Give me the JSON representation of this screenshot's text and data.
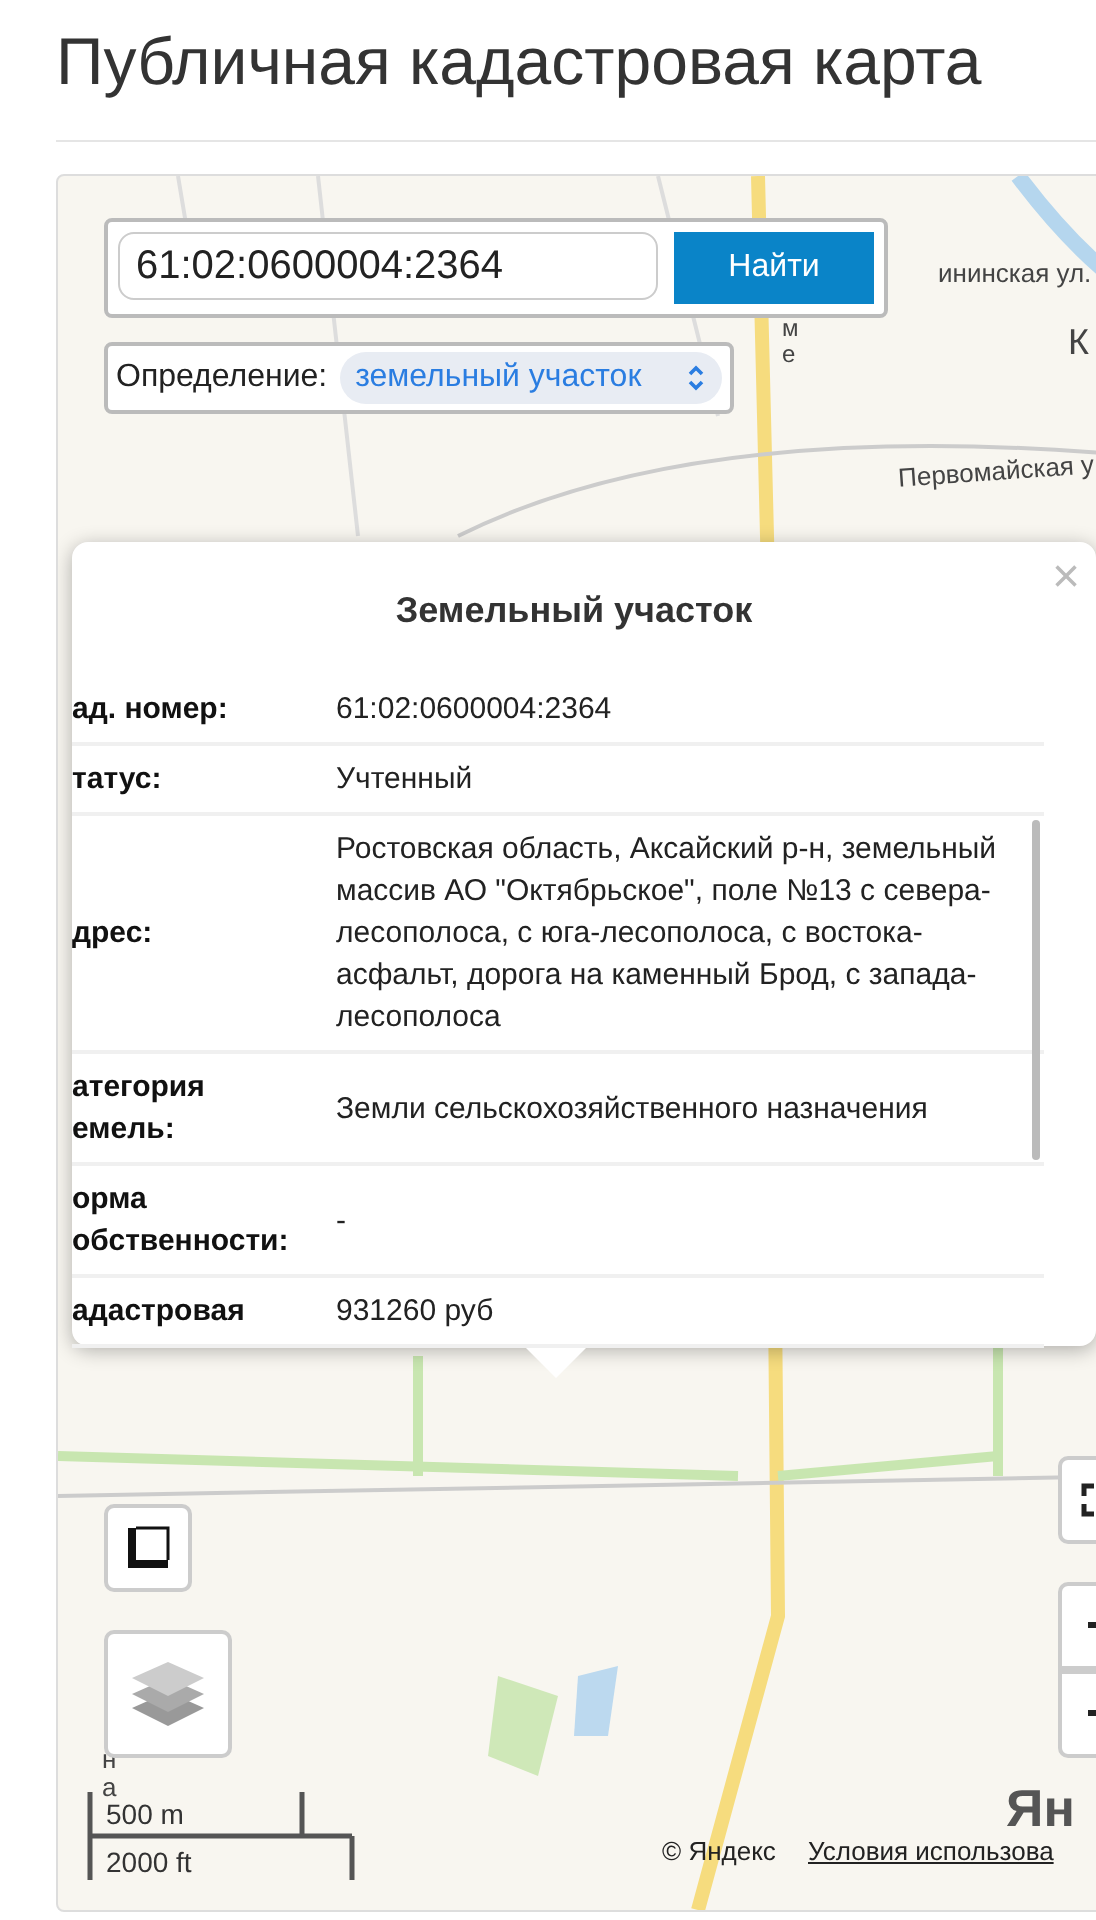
{
  "page_title": "Публичная кадастровая карта",
  "search": {
    "value": "61:02:0600004:2364",
    "button": "Найти"
  },
  "definition": {
    "label": "Определение:",
    "value": "земельный участок"
  },
  "map_labels": [
    {
      "text": "ининская ул."
    },
    {
      "text": "ме"
    },
    {
      "text": "К"
    },
    {
      "text": "Первомайская у"
    },
    {
      "text": "на"
    }
  ],
  "popup": {
    "title": "Земельный участок",
    "close": "×",
    "rows": [
      {
        "label": "ад. номер:",
        "value": "61:02:0600004:2364"
      },
      {
        "label": "татус:",
        "value": "Учтенный"
      },
      {
        "label": "дрес:",
        "value": "Ростовская область, Аксайский р-н, земельный массив АО \"Октябрьское\", поле №13 с севера-лесополоса, с юга-лесополоса, с востока-асфальт, дорога на каменный Брод, с запада-лесополоса"
      },
      {
        "label": "атегория емель:",
        "value": "Земли сельскохозяйственного назначения"
      },
      {
        "label": "орма обственности:",
        "value": "-"
      },
      {
        "label": "адастровая",
        "value": "931260 руб"
      }
    ]
  },
  "scale": {
    "metric": "500 m",
    "imperial": "2000 ft"
  },
  "attribution": {
    "copyright": "© Яндекс",
    "terms": "Условия использова",
    "logo": "Ян"
  }
}
